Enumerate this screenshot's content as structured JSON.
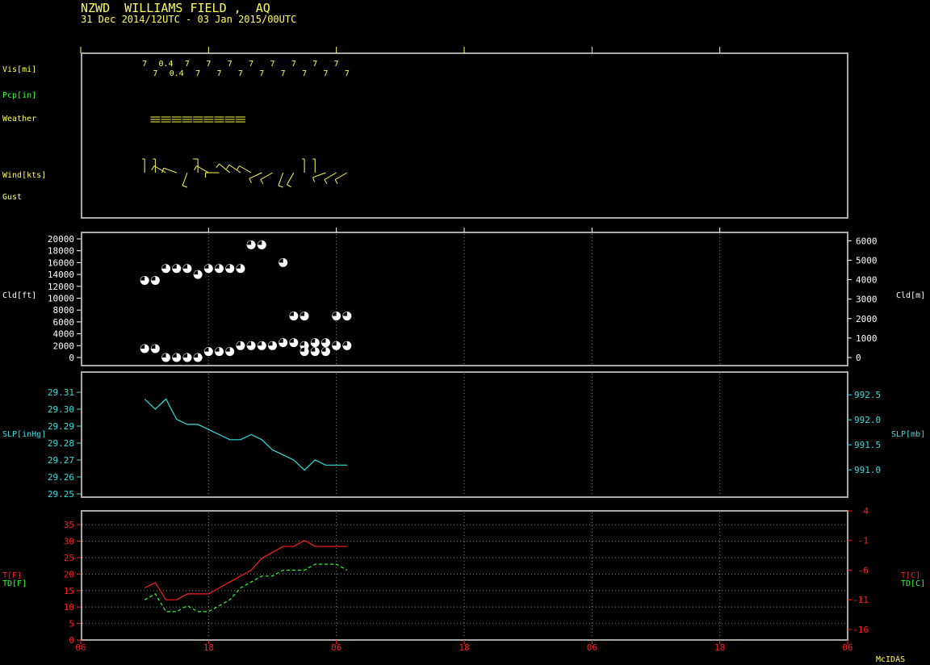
{
  "header": {
    "station": "NZWD  WILLIAMS FIELD ,  AQ",
    "period": "31 Dec 2014/12UTC - 03 Jan 2015/00UTC"
  },
  "footer": {
    "brand": "McIDAS"
  },
  "colors": {
    "background": "#000000",
    "frame": "#a8a8a8",
    "yellow": "#ffff55",
    "green": "#33ff33",
    "cyan": "#33e0e0",
    "red": "#ff2020",
    "white": "#ffffff"
  },
  "labels": {
    "vis": "Vis[mi]",
    "pcp": "Pcp[in]",
    "weather": "Weather",
    "wind": "Wind[kts]",
    "gust": "Gust",
    "cld_ft": "Cld[ft]",
    "cld_m": "Cld[m]",
    "slp_inhg": "SLP[inHg]",
    "slp_mb": "SLP[mb]",
    "t_f": "T[F]",
    "td_f": "TD[F]",
    "t_c": "T[C]",
    "td_c": "TD[C]"
  },
  "chart_data": {
    "type": "line",
    "x_axis": {
      "unit": "hour UTC",
      "range": [
        6,
        78
      ],
      "tick_hours": [
        6,
        18,
        30,
        42,
        54,
        66,
        78
      ],
      "tick_labels": [
        "06",
        "18",
        "06",
        "18",
        "06",
        "18",
        "06"
      ]
    },
    "observation_hours": [
      12,
      13,
      14,
      15,
      16,
      17,
      18,
      19,
      20,
      21,
      22,
      23,
      24,
      25,
      26,
      27,
      28,
      29,
      30,
      31
    ],
    "visibility": {
      "label": "Vis[mi]",
      "row1": [
        {
          "h": 12,
          "v": "7"
        },
        {
          "h": 14,
          "v": "0.4"
        },
        {
          "h": 16,
          "v": "7"
        },
        {
          "h": 18,
          "v": "7"
        },
        {
          "h": 20,
          "v": "7"
        },
        {
          "h": 22,
          "v": "7"
        },
        {
          "h": 24,
          "v": "7"
        },
        {
          "h": 26,
          "v": "7"
        },
        {
          "h": 28,
          "v": "7"
        },
        {
          "h": 30,
          "v": "7"
        }
      ],
      "row2": [
        {
          "h": 13,
          "v": "7"
        },
        {
          "h": 15,
          "v": "0.4"
        },
        {
          "h": 17,
          "v": "7"
        },
        {
          "h": 19,
          "v": "7"
        },
        {
          "h": 21,
          "v": "7"
        },
        {
          "h": 23,
          "v": "7"
        },
        {
          "h": 25,
          "v": "7"
        },
        {
          "h": 27,
          "v": "7"
        },
        {
          "h": 29,
          "v": "7"
        },
        {
          "h": 31,
          "v": "7"
        }
      ]
    },
    "weather": {
      "symbol": "fog",
      "hours": [
        13,
        14,
        15,
        16,
        17,
        18,
        19,
        20,
        21
      ]
    },
    "wind": [
      {
        "h": 12,
        "dir": 360,
        "spd": 5
      },
      {
        "h": 13,
        "dir": 360,
        "spd": 5
      },
      {
        "h": 14,
        "dir": 300,
        "spd": 10
      },
      {
        "h": 15,
        "dir": 290,
        "spd": 10
      },
      {
        "h": 16,
        "dir": 200,
        "spd": 10
      },
      {
        "h": 17,
        "dir": 360,
        "spd": 10
      },
      {
        "h": 18,
        "dir": 300,
        "spd": 10
      },
      {
        "h": 19,
        "dir": 270,
        "spd": 10
      },
      {
        "h": 20,
        "dir": 310,
        "spd": 10
      },
      {
        "h": 21,
        "dir": 305,
        "spd": 10
      },
      {
        "h": 22,
        "dir": 300,
        "spd": 10
      },
      {
        "h": 23,
        "dir": 245,
        "spd": 10
      },
      {
        "h": 24,
        "dir": 240,
        "spd": 10
      },
      {
        "h": 25,
        "dir": 200,
        "spd": 10
      },
      {
        "h": 26,
        "dir": 210,
        "spd": 10
      },
      {
        "h": 27,
        "dir": 360,
        "spd": 5
      },
      {
        "h": 28,
        "dir": 360,
        "spd": 5
      },
      {
        "h": 29,
        "dir": 250,
        "spd": 10
      },
      {
        "h": 30,
        "dir": 240,
        "spd": 10
      },
      {
        "h": 31,
        "dir": 240,
        "spd": 10
      }
    ],
    "cloud": {
      "ylabel_left": "Cld[ft]",
      "ylabel_right": "Cld[m]",
      "ylim_ft": [
        0,
        20000
      ],
      "yticks_ft": [
        0,
        2000,
        4000,
        6000,
        8000,
        10000,
        12000,
        14000,
        16000,
        18000,
        20000
      ],
      "yticks_m": [
        0,
        1000,
        2000,
        3000,
        4000,
        5000,
        6000
      ],
      "layers": [
        {
          "h": 12,
          "ft": 13000,
          "cover": "bkn"
        },
        {
          "h": 13,
          "ft": 13000,
          "cover": "bkn"
        },
        {
          "h": 14,
          "ft": 15000,
          "cover": "bkn"
        },
        {
          "h": 15,
          "ft": 15000,
          "cover": "bkn"
        },
        {
          "h": 16,
          "ft": 15000,
          "cover": "bkn"
        },
        {
          "h": 17,
          "ft": 14000,
          "cover": "bkn"
        },
        {
          "h": 18,
          "ft": 15000,
          "cover": "bkn"
        },
        {
          "h": 19,
          "ft": 15000,
          "cover": "bkn"
        },
        {
          "h": 20,
          "ft": 15000,
          "cover": "bkn"
        },
        {
          "h": 21,
          "ft": 15000,
          "cover": "bkn"
        },
        {
          "h": 22,
          "ft": 19000,
          "cover": "bkn"
        },
        {
          "h": 23,
          "ft": 19000,
          "cover": "bkn"
        },
        {
          "h": 25,
          "ft": 16000,
          "cover": "bkn"
        },
        {
          "h": 26,
          "ft": 7000,
          "cover": "bkn"
        },
        {
          "h": 27,
          "ft": 7000,
          "cover": "bkn"
        },
        {
          "h": 30,
          "ft": 7000,
          "cover": "bkn"
        },
        {
          "h": 31,
          "ft": 7000,
          "cover": "bkn"
        },
        {
          "h": 12,
          "ft": 1500,
          "cover": "bkn"
        },
        {
          "h": 13,
          "ft": 1500,
          "cover": "bkn"
        },
        {
          "h": 14,
          "ft": 0,
          "cover": "bkn"
        },
        {
          "h": 15,
          "ft": 0,
          "cover": "bkn"
        },
        {
          "h": 16,
          "ft": 0,
          "cover": "bkn"
        },
        {
          "h": 17,
          "ft": 0,
          "cover": "bkn"
        },
        {
          "h": 18,
          "ft": 1000,
          "cover": "bkn"
        },
        {
          "h": 19,
          "ft": 1000,
          "cover": "bkn"
        },
        {
          "h": 20,
          "ft": 1000,
          "cover": "bkn"
        },
        {
          "h": 21,
          "ft": 2000,
          "cover": "bkn"
        },
        {
          "h": 22,
          "ft": 2000,
          "cover": "bkn"
        },
        {
          "h": 23,
          "ft": 2000,
          "cover": "bkn"
        },
        {
          "h": 24,
          "ft": 2000,
          "cover": "bkn"
        },
        {
          "h": 25,
          "ft": 2500,
          "cover": "bkn"
        },
        {
          "h": 26,
          "ft": 2500,
          "cover": "bkn"
        },
        {
          "h": 27,
          "ft": 2000,
          "cover": "bkn"
        },
        {
          "h": 28,
          "ft": 2500,
          "cover": "bkn"
        },
        {
          "h": 29,
          "ft": 2500,
          "cover": "bkn"
        },
        {
          "h": 30,
          "ft": 2000,
          "cover": "bkn"
        },
        {
          "h": 31,
          "ft": 2000,
          "cover": "bkn"
        },
        {
          "h": 27,
          "ft": 1000,
          "cover": "bkn"
        },
        {
          "h": 28,
          "ft": 1000,
          "cover": "bkn"
        },
        {
          "h": 29,
          "ft": 1000,
          "cover": "bkn"
        }
      ]
    },
    "slp": {
      "ylabel_left": "SLP[inHg]",
      "ylabel_right": "SLP[mb]",
      "ylim_inhg": [
        29.25,
        29.32
      ],
      "yticks_inhg": [
        "29.25",
        "29.26",
        "29.27",
        "29.28",
        "29.29",
        "29.30",
        "29.31"
      ],
      "yticks_mb": [
        "991.0",
        "991.5",
        "992.0",
        "992.5"
      ],
      "values": [
        {
          "h": 12,
          "v": 29.306
        },
        {
          "h": 13,
          "v": 29.3
        },
        {
          "h": 14,
          "v": 29.306
        },
        {
          "h": 15,
          "v": 29.294
        },
        {
          "h": 16,
          "v": 29.291
        },
        {
          "h": 17,
          "v": 29.291
        },
        {
          "h": 18,
          "v": 29.288
        },
        {
          "h": 19,
          "v": 29.285
        },
        {
          "h": 20,
          "v": 29.282
        },
        {
          "h": 21,
          "v": 29.282
        },
        {
          "h": 22,
          "v": 29.285
        },
        {
          "h": 23,
          "v": 29.282
        },
        {
          "h": 24,
          "v": 29.276
        },
        {
          "h": 25,
          "v": 29.273
        },
        {
          "h": 26,
          "v": 29.27
        },
        {
          "h": 27,
          "v": 29.264
        },
        {
          "h": 28,
          "v": 29.27
        },
        {
          "h": 29,
          "v": 29.267
        },
        {
          "h": 30,
          "v": 29.267
        },
        {
          "h": 31,
          "v": 29.267
        }
      ]
    },
    "temperature": {
      "ylabel_left": [
        "T[F]",
        "TD[F]"
      ],
      "ylabel_right": [
        "T[C]",
        "TD[C]"
      ],
      "ylim_f": [
        0,
        39.2
      ],
      "yticks_f": [
        0,
        5,
        10,
        15,
        20,
        25,
        30,
        35
      ],
      "yticks_c": [
        "-16",
        "-11",
        "-6",
        "-1",
        "4"
      ],
      "series": [
        {
          "name": "T[F]",
          "values": [
            {
              "h": 12,
              "v": 15.8
            },
            {
              "h": 13,
              "v": 17.4
            },
            {
              "h": 14,
              "v": 12.2
            },
            {
              "h": 15,
              "v": 12.2
            },
            {
              "h": 16,
              "v": 14.0
            },
            {
              "h": 17,
              "v": 14.0
            },
            {
              "h": 18,
              "v": 14.0
            },
            {
              "h": 19,
              "v": 15.8
            },
            {
              "h": 20,
              "v": 17.6
            },
            {
              "h": 21,
              "v": 19.4
            },
            {
              "h": 22,
              "v": 21.2
            },
            {
              "h": 23,
              "v": 24.8
            },
            {
              "h": 24,
              "v": 26.6
            },
            {
              "h": 25,
              "v": 28.4
            },
            {
              "h": 26,
              "v": 28.4
            },
            {
              "h": 27,
              "v": 30.2
            },
            {
              "h": 28,
              "v": 28.4
            },
            {
              "h": 29,
              "v": 28.4
            },
            {
              "h": 30,
              "v": 28.4
            },
            {
              "h": 31,
              "v": 28.4
            }
          ]
        },
        {
          "name": "TD[F]",
          "values": [
            {
              "h": 12,
              "v": 12.2
            },
            {
              "h": 13,
              "v": 14.0
            },
            {
              "h": 14,
              "v": 8.6
            },
            {
              "h": 15,
              "v": 8.6
            },
            {
              "h": 16,
              "v": 10.4
            },
            {
              "h": 17,
              "v": 8.6
            },
            {
              "h": 18,
              "v": 8.6
            },
            {
              "h": 19,
              "v": 10.4
            },
            {
              "h": 20,
              "v": 12.2
            },
            {
              "h": 21,
              "v": 15.8
            },
            {
              "h": 22,
              "v": 17.6
            },
            {
              "h": 23,
              "v": 19.4
            },
            {
              "h": 24,
              "v": 19.4
            },
            {
              "h": 25,
              "v": 21.2
            },
            {
              "h": 26,
              "v": 21.2
            },
            {
              "h": 27,
              "v": 21.2
            },
            {
              "h": 28,
              "v": 23.0
            },
            {
              "h": 29,
              "v": 23.0
            },
            {
              "h": 30,
              "v": 23.0
            },
            {
              "h": 31,
              "v": 21.2
            }
          ]
        }
      ]
    }
  }
}
